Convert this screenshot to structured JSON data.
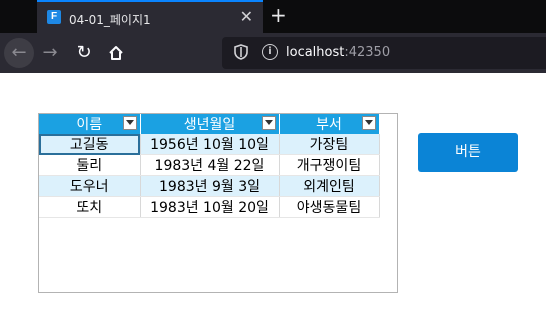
{
  "browser": {
    "tab_title": "04-01_페이지1",
    "favicon_letter": "F",
    "close_glyph": "✕",
    "newtab_glyph": "+",
    "url_host": "localhost",
    "url_port": ":42350",
    "icons": [
      "back-icon",
      "forward-icon",
      "reload-icon",
      "home-icon",
      "shield-icon",
      "info-icon"
    ]
  },
  "grid": {
    "columns": [
      "이름",
      "생년월일",
      "부서"
    ],
    "rows": [
      [
        "고길동",
        "1956년 10월 10일",
        "가장팀"
      ],
      [
        "둘리",
        "1983년 4월 22일",
        "개구쟁이팀"
      ],
      [
        "도우너",
        "1983년 9월 3일",
        "외계인팀"
      ],
      [
        "또치",
        "1983년 10월 20일",
        "야생동물팀"
      ]
    ]
  },
  "button": {
    "label": "버튼"
  },
  "colors": {
    "header": "#1ba1e2",
    "alt_row": "#dcf1fc",
    "button": "#0b84d6"
  }
}
